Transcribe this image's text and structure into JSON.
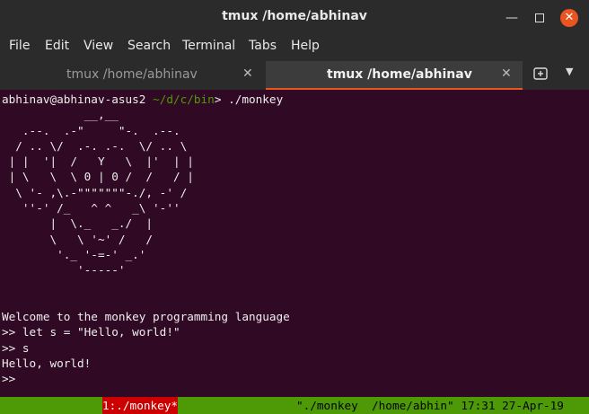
{
  "window": {
    "title": "tmux /home/abhinav",
    "minimize_icon": "minimize-icon",
    "maximize_icon": "maximize-icon",
    "close_icon": "close-icon",
    "close_color": "#e95420"
  },
  "menubar": {
    "items": [
      "File",
      "Edit",
      "View",
      "Search",
      "Terminal",
      "Tabs",
      "Help"
    ]
  },
  "tabs": [
    {
      "label": "tmux /home/abhinav",
      "active": false
    },
    {
      "label": "tmux /home/abhinav",
      "active": true
    }
  ],
  "tab_close_glyph": "✕",
  "terminal": {
    "background": "#300a24",
    "prompt_user": "abhinav@abhinav-asus2",
    "prompt_path": "~/d/c/bin",
    "prompt_suffix": "> ",
    "command": "./monkey",
    "ascii_art": "            __,__\n   .--.  .-\"     \"-.  .--.\n  / .. \\/  .-. .-.  \\/ .. \\\n | |  '|  /   Y   \\  |'  | |\n | \\   \\  \\ 0 | 0 /  /   / |\n  \\ '- ,\\.-\"\"\"\"\"\"\"-./, -' /\n   ''-' /_   ^ ^   _\\ '-''\n       |  \\._   _./  |\n       \\   \\ '~' /   /\n        '._ '-=-' _.'\n           '-----'",
    "output_lines": [
      "Welcome to the monkey programming language",
      ">> let s = \"Hello, world!\"",
      ">> s",
      "Hello, world!",
      ">>"
    ]
  },
  "statusbar": {
    "background": "#4e9a06",
    "window_label": "1:./monkey*",
    "right_text": "\"./monkey  /home/abhin\" 17:31 27-Apr-19"
  }
}
